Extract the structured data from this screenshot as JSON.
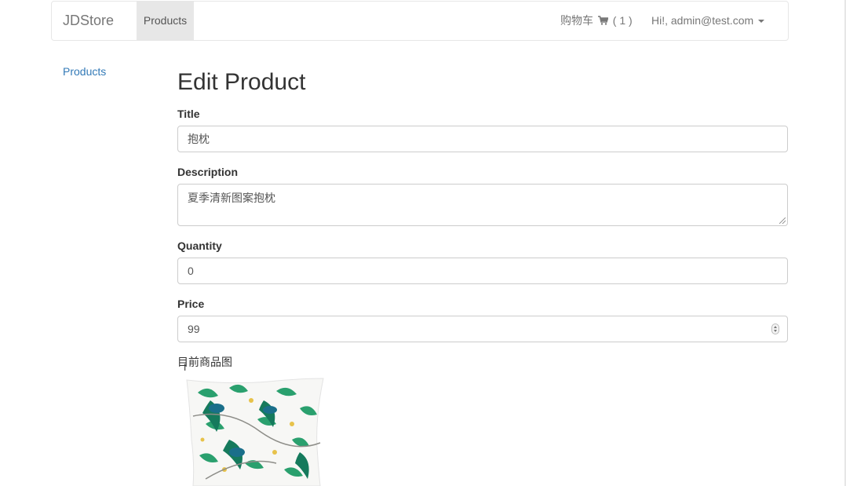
{
  "navbar": {
    "brand": "JDStore",
    "products_tab": "Products",
    "cart_label": "购物车",
    "cart_count": "( 1 )",
    "user_menu": "Hi!, admin@test.com"
  },
  "sidebar": {
    "items": [
      {
        "label": "Products"
      }
    ]
  },
  "page": {
    "title": "Edit Product"
  },
  "form": {
    "title_label": "Title",
    "title_value": "抱枕",
    "description_label": "Description",
    "description_value": "夏季清新图案抱枕",
    "quantity_label": "Quantity",
    "quantity_value": "0",
    "price_label": "Price",
    "price_value": "99",
    "current_image_label": "目前商品图"
  },
  "icons": {
    "cart": "shopping-cart-icon",
    "caret": "caret-down-icon",
    "cursor": "text-cursor-icon"
  },
  "colors": {
    "link": "#337ab7",
    "nav_active_bg": "#e7e7e7",
    "pillow_green": "#1f9a6a",
    "pillow_teal": "#1a6f6a"
  }
}
